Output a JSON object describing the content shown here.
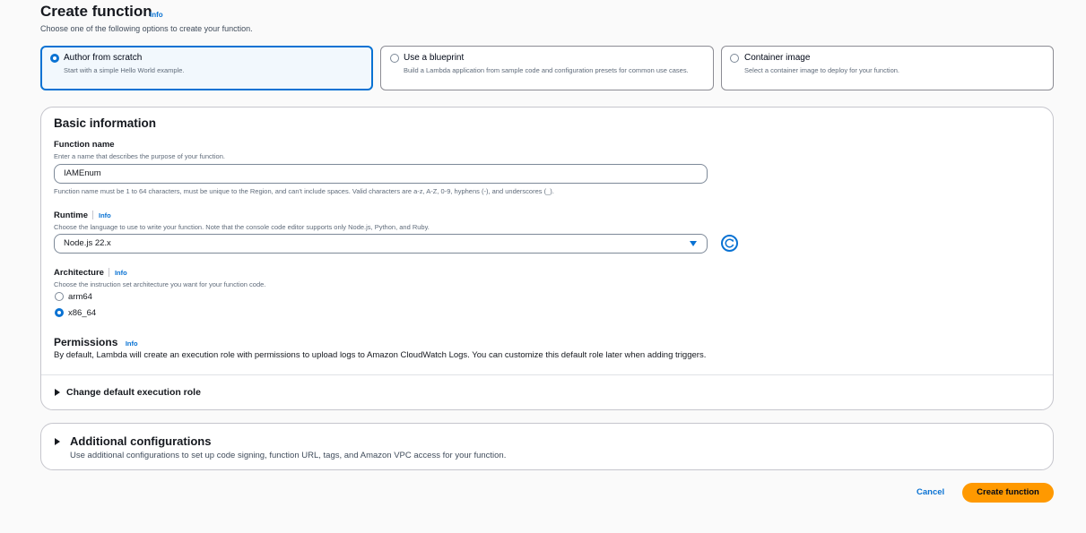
{
  "header": {
    "title": "Create function",
    "info": "Info",
    "subtitle": "Choose one of the following options to create your function."
  },
  "options": [
    {
      "title": "Author from scratch",
      "desc": "Start with a simple Hello World example.",
      "selected": true
    },
    {
      "title": "Use a blueprint",
      "desc": "Build a Lambda application from sample code and configuration presets for common use cases.",
      "selected": false
    },
    {
      "title": "Container image",
      "desc": "Select a container image to deploy for your function.",
      "selected": false
    }
  ],
  "basic": {
    "heading": "Basic information",
    "function_name": {
      "label": "Function name",
      "desc": "Enter a name that describes the purpose of your function.",
      "value": "IAMEnum",
      "constraint": "Function name must be 1 to 64 characters, must be unique to the Region, and can't include spaces. Valid characters are a-z, A-Z, 0-9, hyphens (-), and underscores (_)."
    },
    "runtime": {
      "label": "Runtime",
      "info": "Info",
      "desc": "Choose the language to use to write your function. Note that the console code editor supports only Node.js, Python, and Ruby.",
      "value": "Node.js 22.x"
    },
    "architecture": {
      "label": "Architecture",
      "info": "Info",
      "desc": "Choose the instruction set architecture you want for your function code.",
      "options": [
        {
          "label": "arm64",
          "selected": false
        },
        {
          "label": "x86_64",
          "selected": true
        }
      ]
    },
    "permissions": {
      "heading": "Permissions",
      "info": "Info",
      "desc": "By default, Lambda will create an execution role with permissions to upload logs to Amazon CloudWatch Logs. You can customize this default role later when adding triggers."
    },
    "change_role": "Change default execution role"
  },
  "additional": {
    "heading": "Additional configurations",
    "desc": "Use additional configurations to set up code signing, function URL, tags, and Amazon VPC access for your function."
  },
  "footer": {
    "cancel": "Cancel",
    "create": "Create function"
  },
  "colors": {
    "accent": "#0972d3",
    "primary_button": "#ff9900"
  }
}
